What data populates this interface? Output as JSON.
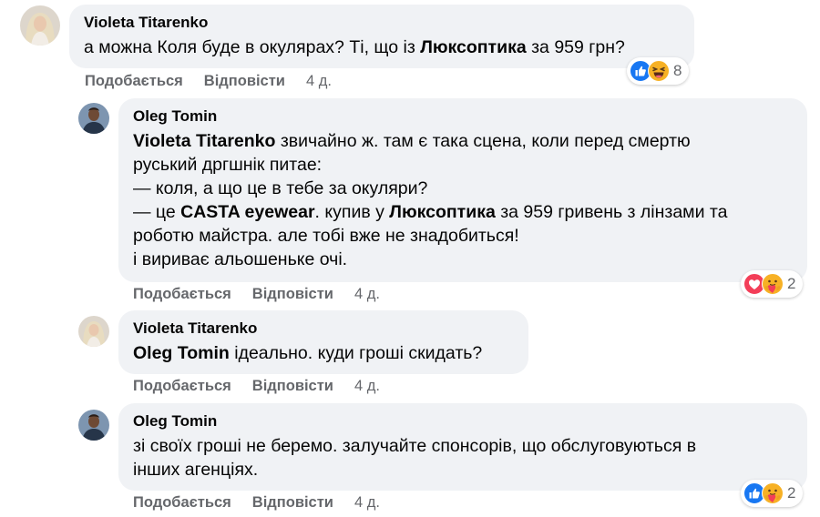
{
  "comments": [
    {
      "author": "Violeta Titarenko",
      "lines": [
        [
          {
            "t": "а можна Коля буде в окулярах? Ті, що із "
          },
          {
            "t": "Люксоптика",
            "b": true
          },
          {
            "t": " за 959 грн?"
          }
        ]
      ],
      "like_label": "Подобається",
      "reply_label": "Відповісти",
      "time": "4 д.",
      "reactions": {
        "icons": [
          "like-icon",
          "haha-icon"
        ],
        "count": "8"
      }
    },
    {
      "author": "Oleg Tomin",
      "lines": [
        [
          {
            "t": "Violeta Titarenko",
            "b": true
          },
          {
            "t": " звичайно ж. там є така сцена, коли перед смертю"
          }
        ],
        [
          {
            "t": "руський дргшнік питае:"
          }
        ],
        [
          {
            "t": "— коля, а що це в тебе за окуляри?"
          }
        ],
        [
          {
            "t": "— це "
          },
          {
            "t": "CASTA eyewear",
            "b": true
          },
          {
            "t": ". купив у "
          },
          {
            "t": "Люксоптика",
            "b": true
          },
          {
            "t": " за 959 гривень з лінзами та"
          }
        ],
        [
          {
            "t": "роботю майстра. але тобі вже не знадобиться!"
          }
        ],
        [
          {
            "t": "і вириває альошеньке очі."
          }
        ]
      ],
      "like_label": "Подобається",
      "reply_label": "Відповісти",
      "time": "4 д.",
      "reactions": {
        "icons": [
          "love-icon",
          "care-icon"
        ],
        "count": "2"
      }
    },
    {
      "author": "Violeta Titarenko",
      "lines": [
        [
          {
            "t": "Oleg Tomin",
            "b": true
          },
          {
            "t": " ідеально. куди гроші скидать?"
          }
        ]
      ],
      "like_label": "Подобається",
      "reply_label": "Відповісти",
      "time": "4 д."
    },
    {
      "author": "Oleg Tomin",
      "lines": [
        [
          {
            "t": "зі своїх гроші не беремо. залучайте спонсорів, що обслуговуються в"
          }
        ],
        [
          {
            "t": "інших агенціях."
          }
        ]
      ],
      "like_label": "Подобається",
      "reply_label": "Відповісти",
      "time": "4 д.",
      "reactions": {
        "icons": [
          "like-icon",
          "care-icon"
        ],
        "count": "2"
      }
    }
  ],
  "colors": {
    "bubble": "#f0f2f5",
    "secondary_text": "#65676b",
    "like_blue": "#1877f2",
    "love_red": "#f33e58",
    "emoji_yellow": "#f7b125"
  }
}
